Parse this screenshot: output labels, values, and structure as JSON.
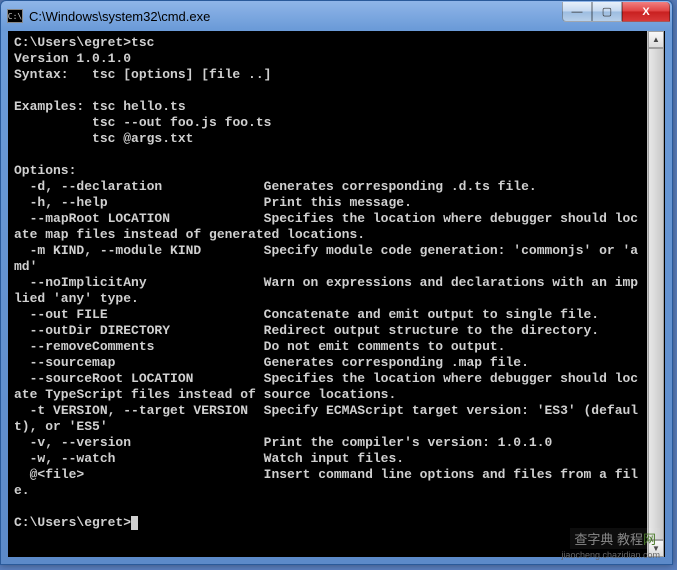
{
  "titlebar": {
    "icon_label": "C:\\",
    "title": "C:\\Windows\\system32\\cmd.exe",
    "min": "—",
    "max": "▢",
    "close": "X"
  },
  "scrollbar": {
    "up": "▲",
    "down": "▼"
  },
  "console": {
    "line01": "C:\\Users\\egret>tsc",
    "line02": "Version 1.0.1.0",
    "line03": "Syntax:   tsc [options] [file ..]",
    "line04": "",
    "line05": "Examples: tsc hello.ts",
    "line06": "          tsc --out foo.js foo.ts",
    "line07": "          tsc @args.txt",
    "line08": "",
    "line09": "Options:",
    "line10": "  -d, --declaration             Generates corresponding .d.ts file.",
    "line11": "  -h, --help                    Print this message.",
    "line12": "  --mapRoot LOCATION            Specifies the location where debugger should loc",
    "line13": "ate map files instead of generated locations.",
    "line14": "  -m KIND, --module KIND        Specify module code generation: 'commonjs' or 'a",
    "line15": "md'",
    "line16": "  --noImplicitAny               Warn on expressions and declarations with an imp",
    "line17": "lied 'any' type.",
    "line18": "  --out FILE                    Concatenate and emit output to single file.",
    "line19": "  --outDir DIRECTORY            Redirect output structure to the directory.",
    "line20": "  --removeComments              Do not emit comments to output.",
    "line21": "  --sourcemap                   Generates corresponding .map file.",
    "line22": "  --sourceRoot LOCATION         Specifies the location where debugger should loc",
    "line23": "ate TypeScript files instead of source locations.",
    "line24": "  -t VERSION, --target VERSION  Specify ECMAScript target version: 'ES3' (defaul",
    "line25": "t), or 'ES5'",
    "line26": "  -v, --version                 Print the compiler's version: 1.0.1.0",
    "line27": "  -w, --watch                   Watch input files.",
    "line28": "  @<file>                       Insert command line options and files from a fil",
    "line29": "e.",
    "line30": "",
    "line31": "C:\\Users\\egret>"
  },
  "watermark": {
    "main_cn": "查字典",
    "main_suffix": " 教程",
    "main_net": "网",
    "sub": "jiaocheng.chazidian.com"
  }
}
